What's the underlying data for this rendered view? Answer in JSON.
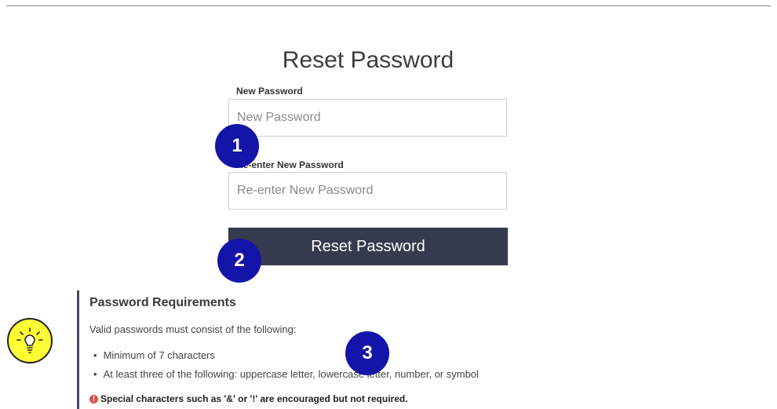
{
  "page": {
    "title": "Reset Password"
  },
  "form": {
    "new_password": {
      "label": "New Password",
      "placeholder": "New Password",
      "value": ""
    },
    "confirm_password": {
      "label": "Re-enter New Password",
      "placeholder": "Re-enter New Password",
      "value": ""
    },
    "submit_label": "Reset Password"
  },
  "callouts": [
    "1",
    "2",
    "3"
  ],
  "requirements": {
    "heading": "Password Requirements",
    "intro": "Valid passwords must consist of the following:",
    "items": [
      "Minimum of 7 characters",
      "At least three of the following: uppercase letter, lowercase letter, number, or symbol"
    ],
    "note": "Special characters such as '&' or '!' are encouraged but not required.",
    "note_icon": "exclamation-circle-icon"
  },
  "tip": {
    "icon": "lightbulb-icon",
    "background": "#ffff33"
  },
  "colors": {
    "button": "#363a4e",
    "callout": "#1414a8",
    "accent_bar": "#444a5c"
  }
}
